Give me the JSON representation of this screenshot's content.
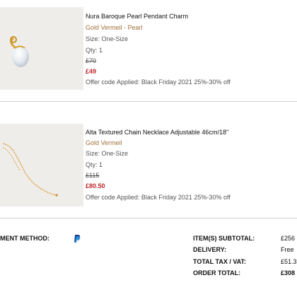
{
  "items": [
    {
      "name": "Nura Baroque Pearl Pendant Charm",
      "variant": "Gold Vermeil - Pearl",
      "size": "Size: One-Size",
      "qty": "Qty: 1",
      "original_price": "£70",
      "sale_price": "£49",
      "offer": "Offer code Applied: Black Friday 2021 25%-30% off",
      "image_icon": "pearl-pendant-icon"
    },
    {
      "name": "Alta Textured Chain Necklace Adjustable 46cm/18\"",
      "variant": "Gold Vermeil",
      "size": "Size: One-Size",
      "qty": "Qty: 1",
      "original_price": "£115",
      "sale_price": "£80.50",
      "offer": "Offer code Applied: Black Friday 2021 25%-30% off",
      "image_icon": "chain-necklace-icon"
    }
  ],
  "payment": {
    "label": "MENT METHOD:",
    "icon": "paypal-icon"
  },
  "summary": {
    "subtotal_label": "ITEM(S) SUBTOTAL:",
    "subtotal_value": "£256",
    "delivery_label": "DELIVERY:",
    "delivery_value": "Free",
    "tax_label": "TOTAL TAX / VAT:",
    "tax_value": "£51.3",
    "order_total_label": "ORDER TOTAL:",
    "order_total_value": "£308"
  },
  "colors": {
    "variant": "#a0703a",
    "sale_price": "#c0272d",
    "thumb_bg": "#efedea",
    "paypal_dark": "#1a3f8f",
    "paypal_light": "#2a8fd8"
  }
}
